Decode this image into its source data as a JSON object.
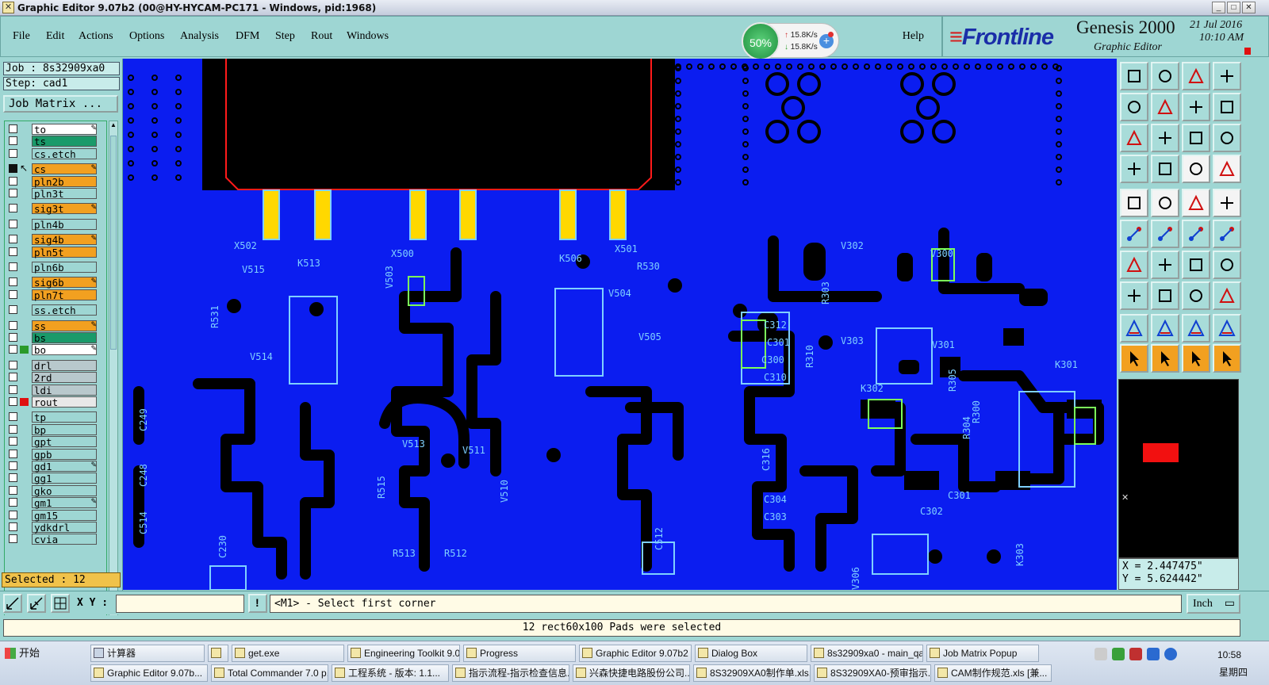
{
  "window": {
    "title": "Graphic Editor 9.07b2 (00@HY-HYCAM-PC171 - Windows, pid:1968)",
    "controls": [
      "_",
      "□",
      "✕"
    ]
  },
  "menu": {
    "items": [
      "File",
      "Edit",
      "Actions",
      "Options",
      "Analysis",
      "DFM",
      "Step",
      "Rout",
      "Windows"
    ],
    "help": "Help"
  },
  "network_widget": {
    "percent": "50%",
    "upload": "15.8K/s",
    "download": "15.8K/s"
  },
  "brand": {
    "logo": "Frontline",
    "product": "Genesis 2000",
    "subtitle": "Graphic Editor",
    "date": "21 Jul 2016",
    "time": "10:10 AM"
  },
  "job": {
    "job_label": "Job : 8s32909xa0",
    "step_label": "Step: cad1",
    "matrix_button": "Job Matrix ...",
    "selected": "Selected : 12"
  },
  "layers": [
    {
      "name": "to",
      "color": "#ffffff",
      "pen": true
    },
    {
      "name": "ts",
      "color": "#1a9a6a",
      "pen": false
    },
    {
      "name": "cs.etch",
      "color": "#9ed6d3",
      "pen": false
    },
    {
      "name": "cs",
      "color": "#f2a020",
      "pen": true,
      "active": true
    },
    {
      "name": "pln2b",
      "color": "#f2a020",
      "pen": false
    },
    {
      "name": "pln3t",
      "color": "#9ed6d3",
      "pen": false
    },
    {
      "name": "sig3t",
      "color": "#f2a020",
      "pen": true
    },
    {
      "name": "pln4b",
      "color": "#9ed6d3",
      "pen": false
    },
    {
      "name": "sig4b",
      "color": "#f2a020",
      "pen": true
    },
    {
      "name": "pln5t",
      "color": "#f2a020",
      "pen": false
    },
    {
      "name": "pln6b",
      "color": "#9ed6d3",
      "pen": false
    },
    {
      "name": "sig6b",
      "color": "#f2a020",
      "pen": true
    },
    {
      "name": "pln7t",
      "color": "#f2a020",
      "pen": false
    },
    {
      "name": "ss.etch",
      "color": "#9ed6d3",
      "pen": false
    },
    {
      "name": "ss",
      "color": "#f2a020",
      "pen": true
    },
    {
      "name": "bs",
      "color": "#1a9a6a",
      "pen": false
    },
    {
      "name": "bo",
      "color": "#ffffff",
      "pen": true,
      "swatch": "#2a9a2a"
    },
    {
      "name": "drl",
      "color": "#b8c8cc",
      "pen": false
    },
    {
      "name": "2rd",
      "color": "#b8c8cc",
      "pen": false
    },
    {
      "name": "ldi",
      "color": "#b8c8cc",
      "pen": false
    },
    {
      "name": "rout",
      "color": "#e8e8e8",
      "pen": false,
      "swatch": "#e01010"
    },
    {
      "name": "tp",
      "color": "#9ed6d3",
      "pen": false
    },
    {
      "name": "bp",
      "color": "#9ed6d3",
      "pen": false
    },
    {
      "name": "gpt",
      "color": "#9ed6d3",
      "pen": false
    },
    {
      "name": "gpb",
      "color": "#9ed6d3",
      "pen": false
    },
    {
      "name": "gd1",
      "color": "#9ed6d3",
      "pen": true
    },
    {
      "name": "gg1",
      "color": "#9ed6d3",
      "pen": false
    },
    {
      "name": "gko",
      "color": "#9ed6d3",
      "pen": false
    },
    {
      "name": "gm1",
      "color": "#9ed6d3",
      "pen": true
    },
    {
      "name": "gm15",
      "color": "#9ed6d3",
      "pen": false
    },
    {
      "name": "ydkdrl",
      "color": "#9ed6d3",
      "pen": false
    },
    {
      "name": "cvia",
      "color": "#9ed6d3",
      "pen": false
    }
  ],
  "canvas": {
    "background": "#0b1df0",
    "labels": [
      "X502",
      "V515",
      "K513",
      "X500",
      "V503",
      "K506",
      "X501",
      "R530",
      "V504",
      "V505",
      "R531",
      "V514",
      "R303",
      "C312",
      "C301",
      "C300",
      "C310",
      "R310",
      "V303",
      "V302",
      "V300",
      "V301",
      "K302",
      "K301",
      "R305",
      "V513",
      "V511",
      "R512",
      "R513",
      "R515",
      "V510",
      "C230",
      "C512",
      "C301",
      "C302",
      "C303",
      "C304",
      "K303",
      "V306",
      "R300",
      "R304",
      "C248",
      "C249",
      "C514",
      "C316"
    ]
  },
  "right_tools": {
    "rows": 12,
    "cols": 4
  },
  "coordinates": {
    "x": "X = 2.447475\"",
    "y": "Y = 5.624442\""
  },
  "command": {
    "xy_label": "X Y :",
    "xy_value": "",
    "message": "<M1> - Select first corner",
    "unit": "Inch"
  },
  "status": {
    "message": "12 rect60x100 Pads were selected"
  },
  "taskbar": {
    "start": "开始",
    "row1": [
      "计算器",
      "",
      "get.exe",
      "Engineering Toolkit 9.0...",
      "Progress",
      "Graphic Editor 9.07b2 (...",
      "Dialog Box",
      "8s32909xa0 - main_qa",
      "Job Matrix Popup"
    ],
    "row2": [
      "Graphic Editor 9.07b...",
      "Total Commander 7.0 p...",
      "工程系统 - 版本: 1.1...",
      "指示流程-指示检查信息...",
      "兴森快捷电路股份公司...",
      "8S32909XA0制作单.xls...",
      "8S32909XA0-预审指示...",
      "CAM制作规范.xls [兼..."
    ],
    "clock": "10:58",
    "day": "星期四"
  }
}
